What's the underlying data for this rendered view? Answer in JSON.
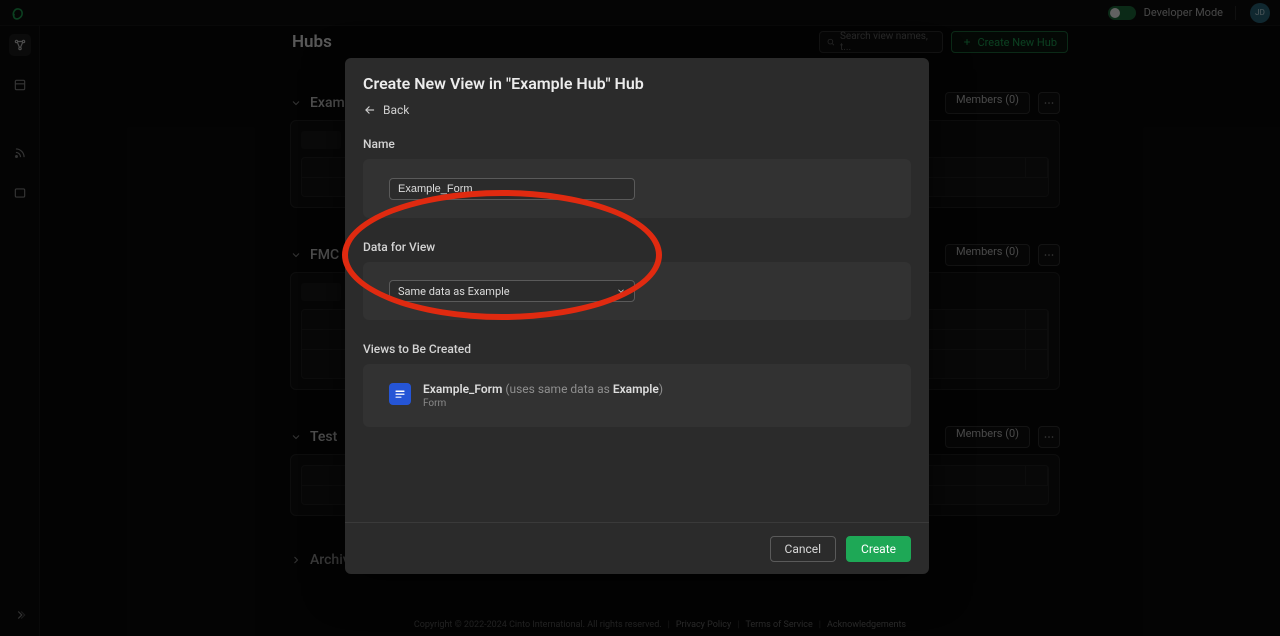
{
  "topbar": {
    "dev_mode_label": "Developer Mode",
    "avatar_initials": "JD"
  },
  "sidebar_icons": [
    "hub-icon",
    "board-icon",
    "feed-icon",
    "panel-icon"
  ],
  "header": {
    "title": "Hubs",
    "search_placeholder": "Search view names, t...",
    "create_button": "Create New Hub"
  },
  "hubs": [
    {
      "name": "Example Hub",
      "members_label": "Members (0)"
    },
    {
      "name": "FMC",
      "members_label": "Members (0)"
    },
    {
      "name": "Test",
      "members_label": "Members (0)"
    }
  ],
  "archived_label": "Archived Views",
  "footer": {
    "copyright": "Copyright © 2022-2024 Cinto International. All rights reserved.",
    "privacy": "Privacy Policy",
    "terms": "Terms of Service",
    "ack": "Acknowledgements"
  },
  "modal": {
    "title": "Create New View in \"Example Hub\" Hub",
    "back_label": "Back",
    "name_label": "Name",
    "name_value": "Example_Form",
    "data_label": "Data for View",
    "data_value": "Same data as Example",
    "views_label": "Views to Be Created",
    "view_item": {
      "name": "Example_Form",
      "uses_prefix": " (uses same data as ",
      "uses_bold": "Example",
      "uses_suffix": ")",
      "type": "Form"
    },
    "cancel": "Cancel",
    "create": "Create"
  }
}
